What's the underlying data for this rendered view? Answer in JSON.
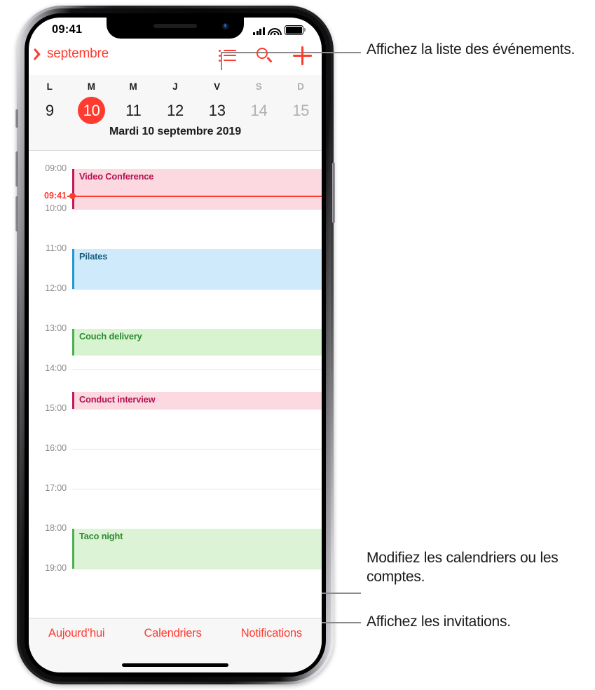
{
  "statusbar": {
    "time": "09:41",
    "signal_icon": "cellular-signal-icon",
    "wifi_icon": "wifi-icon",
    "battery_icon": "battery-full-icon"
  },
  "navbar": {
    "back_label": "septembre",
    "back_icon": "chevron-left-icon",
    "list_icon": "list-view-icon",
    "search_icon": "search-icon",
    "add_icon": "plus-icon"
  },
  "weekstrip": {
    "days": [
      {
        "dow": "L",
        "num": "9",
        "selected": false,
        "dim": false
      },
      {
        "dow": "M",
        "num": "10",
        "selected": true,
        "dim": false
      },
      {
        "dow": "M",
        "num": "11",
        "selected": false,
        "dim": false
      },
      {
        "dow": "J",
        "num": "12",
        "selected": false,
        "dim": false
      },
      {
        "dow": "V",
        "num": "13",
        "selected": false,
        "dim": false
      },
      {
        "dow": "S",
        "num": "14",
        "selected": false,
        "dim": true
      },
      {
        "dow": "D",
        "num": "15",
        "selected": false,
        "dim": true
      }
    ],
    "day_title": "Mardi  10 septembre 2019"
  },
  "daygrid": {
    "hours": [
      "09:00",
      "10:00",
      "11:00",
      "12:00",
      "13:00",
      "14:00",
      "15:00",
      "16:00",
      "17:00",
      "18:00",
      "19:00"
    ],
    "now_label": "09:41",
    "events": [
      {
        "title": "Video Conference",
        "start": "09:00",
        "end": "10:00",
        "fill": "#fcd8e1",
        "bar": "#c2175b",
        "text": "#b3124f"
      },
      {
        "title": "Pilates",
        "start": "11:00",
        "end": "12:00",
        "fill": "#cfeafb",
        "bar": "#2196d4",
        "text": "#1a5d7e"
      },
      {
        "title": "Couch delivery",
        "start": "13:00",
        "end": "13:40",
        "fill": "#d8f3d0",
        "bar": "#4caf50",
        "text": "#2f8a34"
      },
      {
        "title": "Conduct interview",
        "start": "14:35",
        "end": "15:00",
        "fill": "#fcd8e1",
        "bar": "#c2175b",
        "text": "#b3124f"
      },
      {
        "title": "Taco night",
        "start": "18:00",
        "end": "19:00",
        "fill": "#ddf3d5",
        "bar": "#4caf50",
        "text": "#2f8a34"
      }
    ]
  },
  "toolbar": {
    "today_label": "Aujourd’hui",
    "calendars_label": "Calendriers",
    "notifications_label": "Notifications"
  },
  "callouts": {
    "list_view": "Affichez la liste des événements.",
    "calendars": "Modifiez les calendriers ou les comptes.",
    "notifications": "Affichez les invitations."
  },
  "colors": {
    "accent_red": "#ff3b30",
    "leader_gray": "#8a8a8a",
    "chrome_bg": "#f7f7f7"
  }
}
